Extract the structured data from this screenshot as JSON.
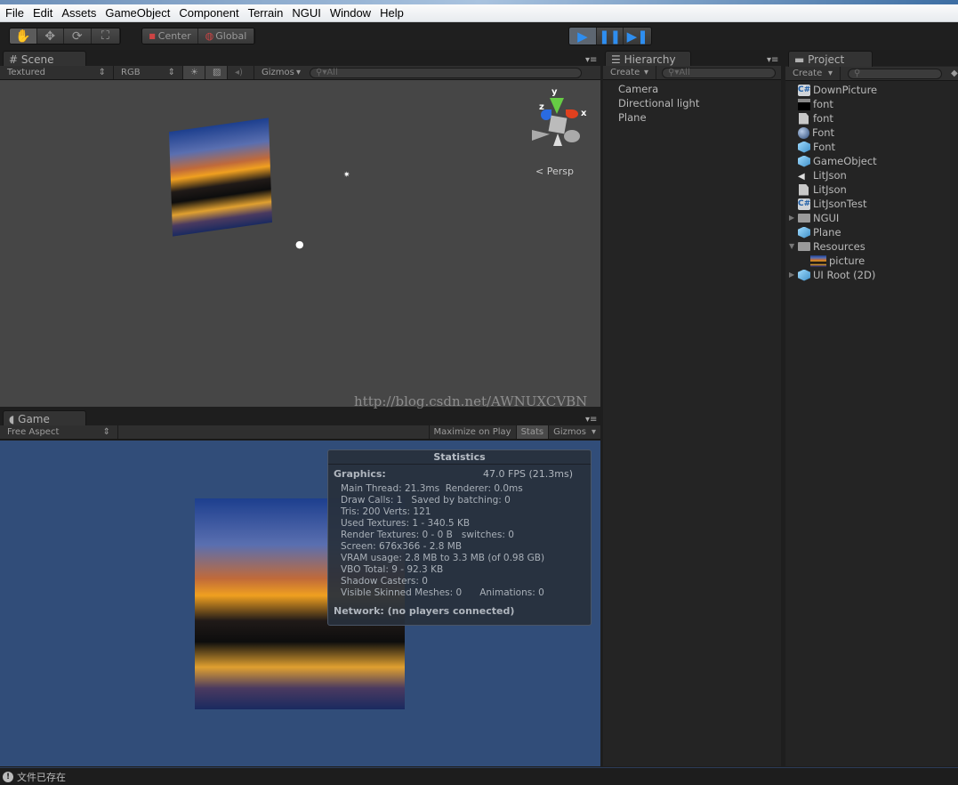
{
  "menubar": {
    "items": [
      "File",
      "Edit",
      "Assets",
      "GameObject",
      "Component",
      "Terrain",
      "NGUI",
      "Window",
      "Help"
    ]
  },
  "toolbar": {
    "tools": [
      "hand-icon",
      "move-icon",
      "rotate-icon",
      "scale-icon"
    ],
    "pivot_center": "Center",
    "pivot_global": "Global",
    "play": "play-icon",
    "pause": "pause-icon",
    "step": "step-icon",
    "accent": "#2e8ef0"
  },
  "scene": {
    "tab": "Scene",
    "render_mode": "Textured",
    "channel": "RGB",
    "gizmos": "Gizmos",
    "search_placeholder": "All",
    "persp": "Persp",
    "axis_x": "x",
    "axis_y": "y",
    "axis_z": "z",
    "bg": "#464646"
  },
  "game": {
    "tab": "Game",
    "aspect": "Free Aspect",
    "maximize": "Maximize on Play",
    "stats": "Stats",
    "gizmos": "Gizmos",
    "bg": "#314d79"
  },
  "statistics": {
    "title": "Statistics",
    "graphics_label": "Graphics:",
    "fps": "47.0 FPS (21.3ms)",
    "lines": [
      "Main Thread: 21.3ms  Renderer: 0.0ms",
      "Draw Calls: 1   Saved by batching: 0",
      "Tris: 200 Verts: 121",
      "Used Textures: 1 - 340.5 KB",
      "Render Textures: 0 - 0 B   switches: 0",
      "Screen: 676x366 - 2.8 MB",
      "VRAM usage: 2.8 MB to 3.3 MB (of 0.98 GB)",
      "VBO Total: 9 - 92.3 KB",
      "Shadow Casters: 0",
      "Visible Skinned Meshes: 0      Animations: 0"
    ],
    "network": "Network: (no players connected)"
  },
  "hierarchy": {
    "tab": "Hierarchy",
    "create": "Create",
    "search_placeholder": "All",
    "items": [
      "Camera",
      "Directional light",
      "Plane"
    ]
  },
  "project": {
    "tab": "Project",
    "create": "Create",
    "items": [
      {
        "label": "DownPicture",
        "icon": "csharp-script",
        "indent": 0,
        "arrow": ""
      },
      {
        "label": "font",
        "icon": "texture",
        "indent": 0,
        "arrow": ""
      },
      {
        "label": "font",
        "icon": "text-asset",
        "indent": 0,
        "arrow": ""
      },
      {
        "label": "Font",
        "icon": "material",
        "indent": 0,
        "arrow": ""
      },
      {
        "label": "Font",
        "icon": "prefab",
        "indent": 0,
        "arrow": ""
      },
      {
        "label": "GameObject",
        "icon": "prefab",
        "indent": 0,
        "arrow": ""
      },
      {
        "label": "LitJson",
        "icon": "unity-asset",
        "indent": 0,
        "arrow": ""
      },
      {
        "label": "LitJson",
        "icon": "document",
        "indent": 0,
        "arrow": ""
      },
      {
        "label": "LitJsonTest",
        "icon": "csharp-script",
        "indent": 0,
        "arrow": ""
      },
      {
        "label": "NGUI",
        "icon": "folder",
        "indent": 0,
        "arrow": "▶"
      },
      {
        "label": "Plane",
        "icon": "prefab",
        "indent": 0,
        "arrow": ""
      },
      {
        "label": "Resources",
        "icon": "folder",
        "indent": 0,
        "arrow": "▼"
      },
      {
        "label": "picture",
        "icon": "texture-picture",
        "indent": 1,
        "arrow": ""
      },
      {
        "label": "UI Root (2D)",
        "icon": "prefab",
        "indent": 0,
        "arrow": "▶"
      }
    ]
  },
  "watermark": "http://blog.csdn.net/AWNUXCVBN",
  "statusbar": {
    "message": "文件已存在",
    "icon": "info-icon"
  }
}
